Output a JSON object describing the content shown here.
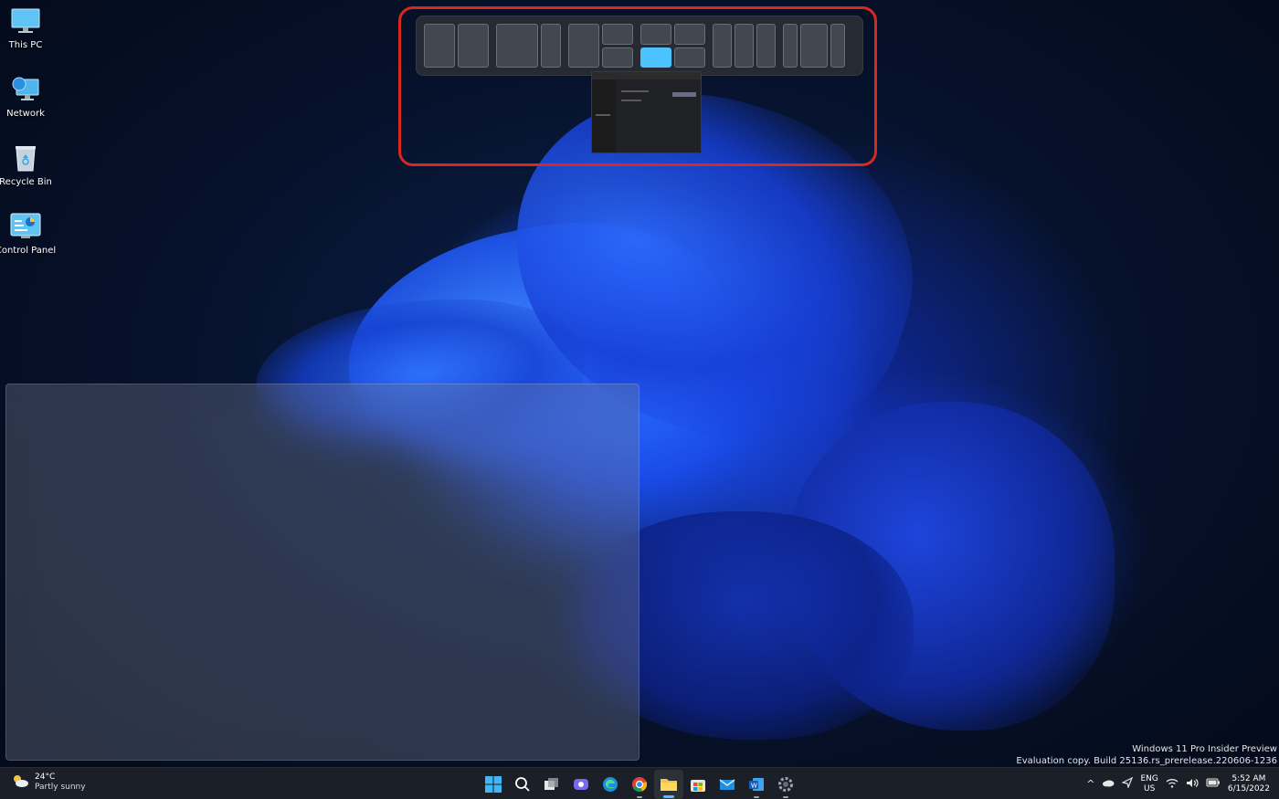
{
  "desktop": {
    "icons": [
      {
        "label": "This PC",
        "icon": "monitor-icon"
      },
      {
        "label": "Network",
        "icon": "network-icon"
      },
      {
        "label": "Recycle Bin",
        "icon": "recycle-bin-icon"
      },
      {
        "label": "Control Panel",
        "icon": "control-panel-icon"
      }
    ]
  },
  "snap_layouts": {
    "layouts": [
      "two-halves",
      "wide-narrow",
      "one-plus-two",
      "quad",
      "three-columns",
      "narrow-wide-narrow"
    ],
    "highlight_color": "#4cc2ff",
    "annotation_color": "#d8291f"
  },
  "watermark": {
    "line1": "Windows 11 Pro Insider Preview",
    "line2": "Evaluation copy. Build 25136.rs_prerelease.220606-1236"
  },
  "taskbar": {
    "weather": {
      "temperature": "24°C",
      "condition": "Partly sunny"
    },
    "apps": [
      "start-icon",
      "search-icon",
      "task-view-icon",
      "chat-icon",
      "edge-icon",
      "chrome-icon",
      "file-explorer-icon",
      "store-icon",
      "mail-icon",
      "word-icon",
      "settings-icon"
    ],
    "tray": {
      "lang_line1": "ENG",
      "lang_line2": "US",
      "time": "5:52 AM",
      "date": "6/15/2022",
      "chevron": "^"
    },
    "accent": "#4cc2ff"
  }
}
